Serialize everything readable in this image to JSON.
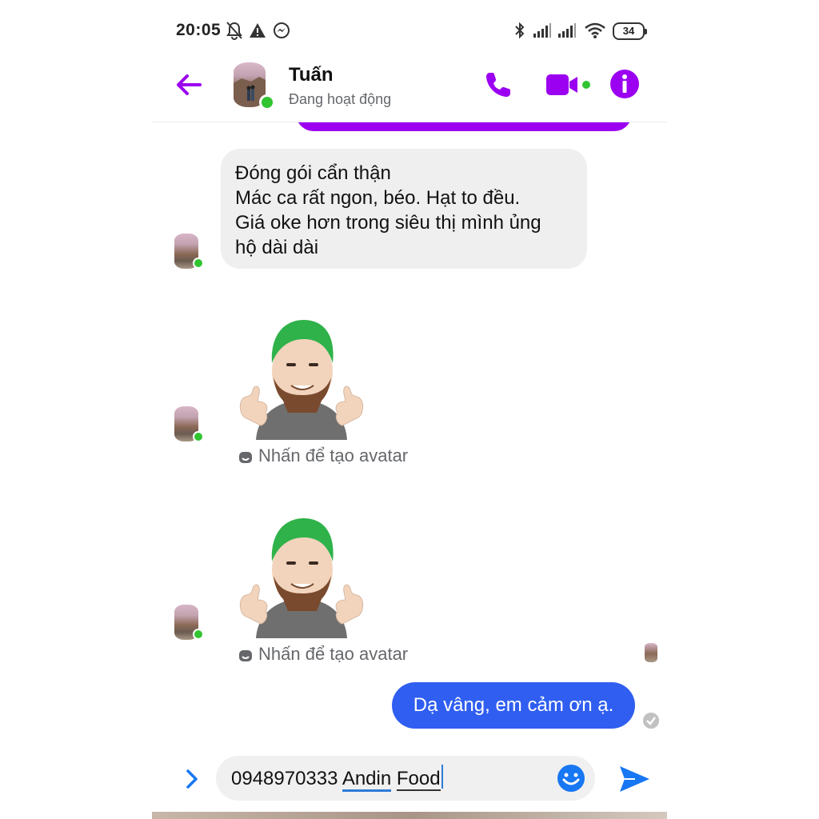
{
  "status_bar": {
    "time": "20:05",
    "battery": "34"
  },
  "header": {
    "contact_name": "Tuấn",
    "status": "Đang hoạt động",
    "icons": [
      "back-arrow-icon",
      "phone-icon",
      "video-camera-icon",
      "info-icon"
    ]
  },
  "messages": {
    "incoming_lines": [
      "Đóng gói cẩn thận",
      "Mác ca rất ngon, béo. Hạt to đều.",
      "Giá oke hơn trong siêu thị mình ủng",
      "hộ dài dài"
    ],
    "sticker_hint_1": "Nhấn để tạo avatar",
    "sticker_hint_2": "Nhấn để tạo avatar",
    "outgoing": "Dạ vâng, em cảm ơn ạ."
  },
  "composer": {
    "text_prefix": "0948970333 ",
    "text_word_1": "Andin",
    "text_word_2": "Food"
  },
  "colors": {
    "accent": "#9b00f0",
    "outgoing_bubble": "#2f5ef0",
    "online": "#31c431",
    "send": "#1877f2"
  }
}
